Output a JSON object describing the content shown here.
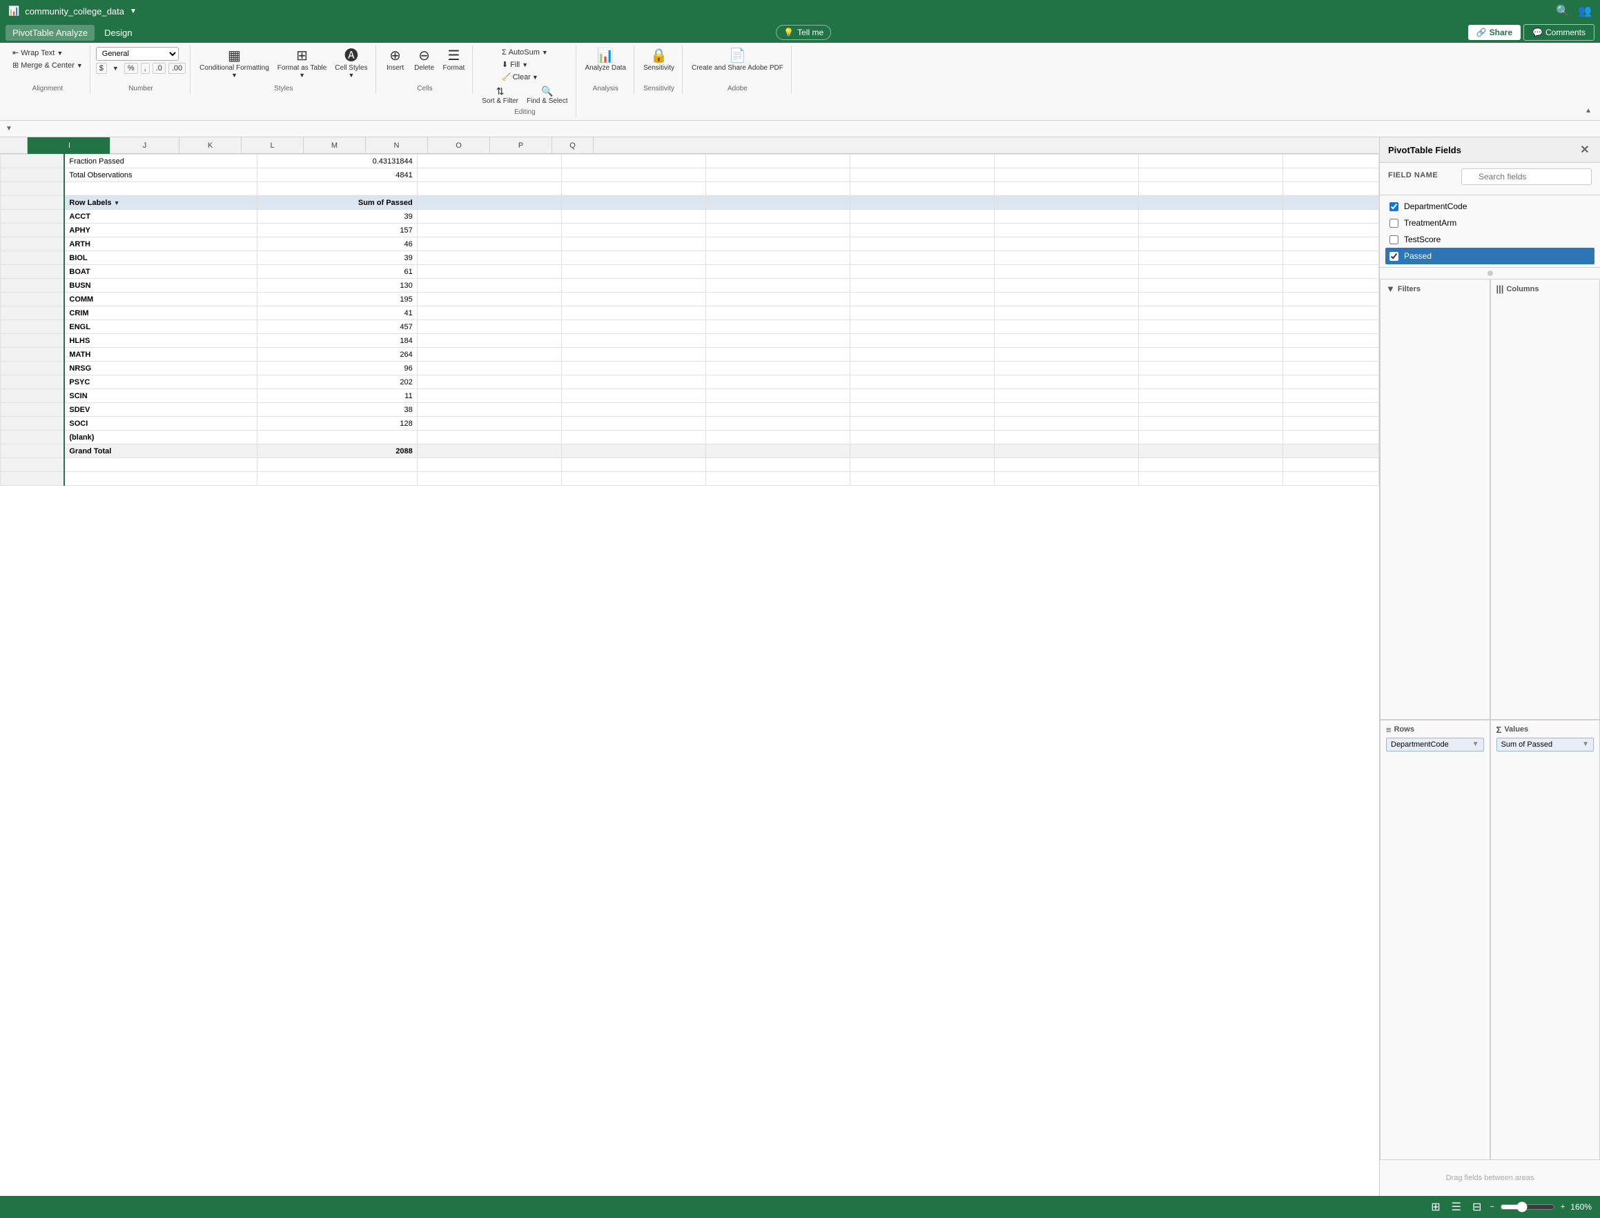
{
  "titleBar": {
    "filename": "community_college_data",
    "searchIcon": "🔍",
    "peopleIcon": "👥"
  },
  "menuBar": {
    "tabs": [
      "PivotTable Analyze",
      "Design"
    ],
    "tellMe": "Tell me",
    "share": "Share",
    "comments": "Comments"
  },
  "ribbon": {
    "wrapText": "Wrap Text",
    "mergeCenter": "Merge & Center",
    "numberFormat": "General",
    "conditionalFormatting": "Conditional Formatting",
    "formatAsTable": "Format as Table",
    "cellStyles": "Cell Styles",
    "insert": "Insert",
    "delete": "Delete",
    "format": "Format",
    "autoSum": "AutoSum",
    "fill": "Fill",
    "clear": "Clear",
    "sortFilter": "Sort & Filter",
    "findSelect": "Find & Select",
    "analyzeData": "Analyze Data",
    "sensitivity": "Sensitivity",
    "createSharePDF": "Create and Share Adobe PDF"
  },
  "spreadsheet": {
    "columns": [
      "I",
      "J",
      "K",
      "L",
      "M",
      "N",
      "O",
      "P",
      "Q"
    ],
    "topRows": [
      {
        "rowNum": "",
        "col_i": "Fraction Passed",
        "col_j": "0.43131844"
      },
      {
        "rowNum": "",
        "col_i": "Total Observations",
        "col_j": "4841"
      }
    ],
    "pivotTable": {
      "headers": [
        "Row Labels",
        "Sum of Passed"
      ],
      "rows": [
        {
          "label": "ACCT",
          "value": "39"
        },
        {
          "label": "APHY",
          "value": "157"
        },
        {
          "label": "ARTH",
          "value": "46"
        },
        {
          "label": "BIOL",
          "value": "39"
        },
        {
          "label": "BOAT",
          "value": "61"
        },
        {
          "label": "BUSN",
          "value": "130"
        },
        {
          "label": "COMM",
          "value": "195"
        },
        {
          "label": "CRIM",
          "value": "41"
        },
        {
          "label": "ENGL",
          "value": "457"
        },
        {
          "label": "HLHS",
          "value": "184"
        },
        {
          "label": "MATH",
          "value": "264"
        },
        {
          "label": "NRSG",
          "value": "96"
        },
        {
          "label": "PSYC",
          "value": "202"
        },
        {
          "label": "SCIN",
          "value": "11"
        },
        {
          "label": "SDEV",
          "value": "38"
        },
        {
          "label": "SOCI",
          "value": "128"
        },
        {
          "label": "(blank)",
          "value": ""
        }
      ],
      "grandTotal": {
        "label": "Grand Total",
        "value": "2088"
      }
    }
  },
  "pivotPanel": {
    "title": "PivotTable Fields",
    "fieldNameLabel": "FIELD NAME",
    "searchPlaceholder": "Search fields",
    "fields": [
      {
        "name": "DepartmentCode",
        "checked": true,
        "selected": false
      },
      {
        "name": "TreatmentArm",
        "checked": false,
        "selected": false
      },
      {
        "name": "TestScore",
        "checked": false,
        "selected": false
      },
      {
        "name": "Passed",
        "checked": true,
        "selected": true
      }
    ],
    "areas": {
      "filters": {
        "label": "Filters",
        "icon": "▼",
        "chips": []
      },
      "columns": {
        "label": "Columns",
        "icon": "|||",
        "chips": []
      },
      "rows": {
        "label": "Rows",
        "icon": "≡",
        "chips": [
          {
            "name": "DepartmentCode"
          }
        ]
      },
      "values": {
        "label": "Values",
        "icon": "Σ",
        "chips": [
          {
            "name": "Sum of Passed"
          }
        ]
      }
    },
    "dragHint": "Drag fields between areas"
  },
  "statusBar": {
    "zoomLevel": "160%"
  }
}
